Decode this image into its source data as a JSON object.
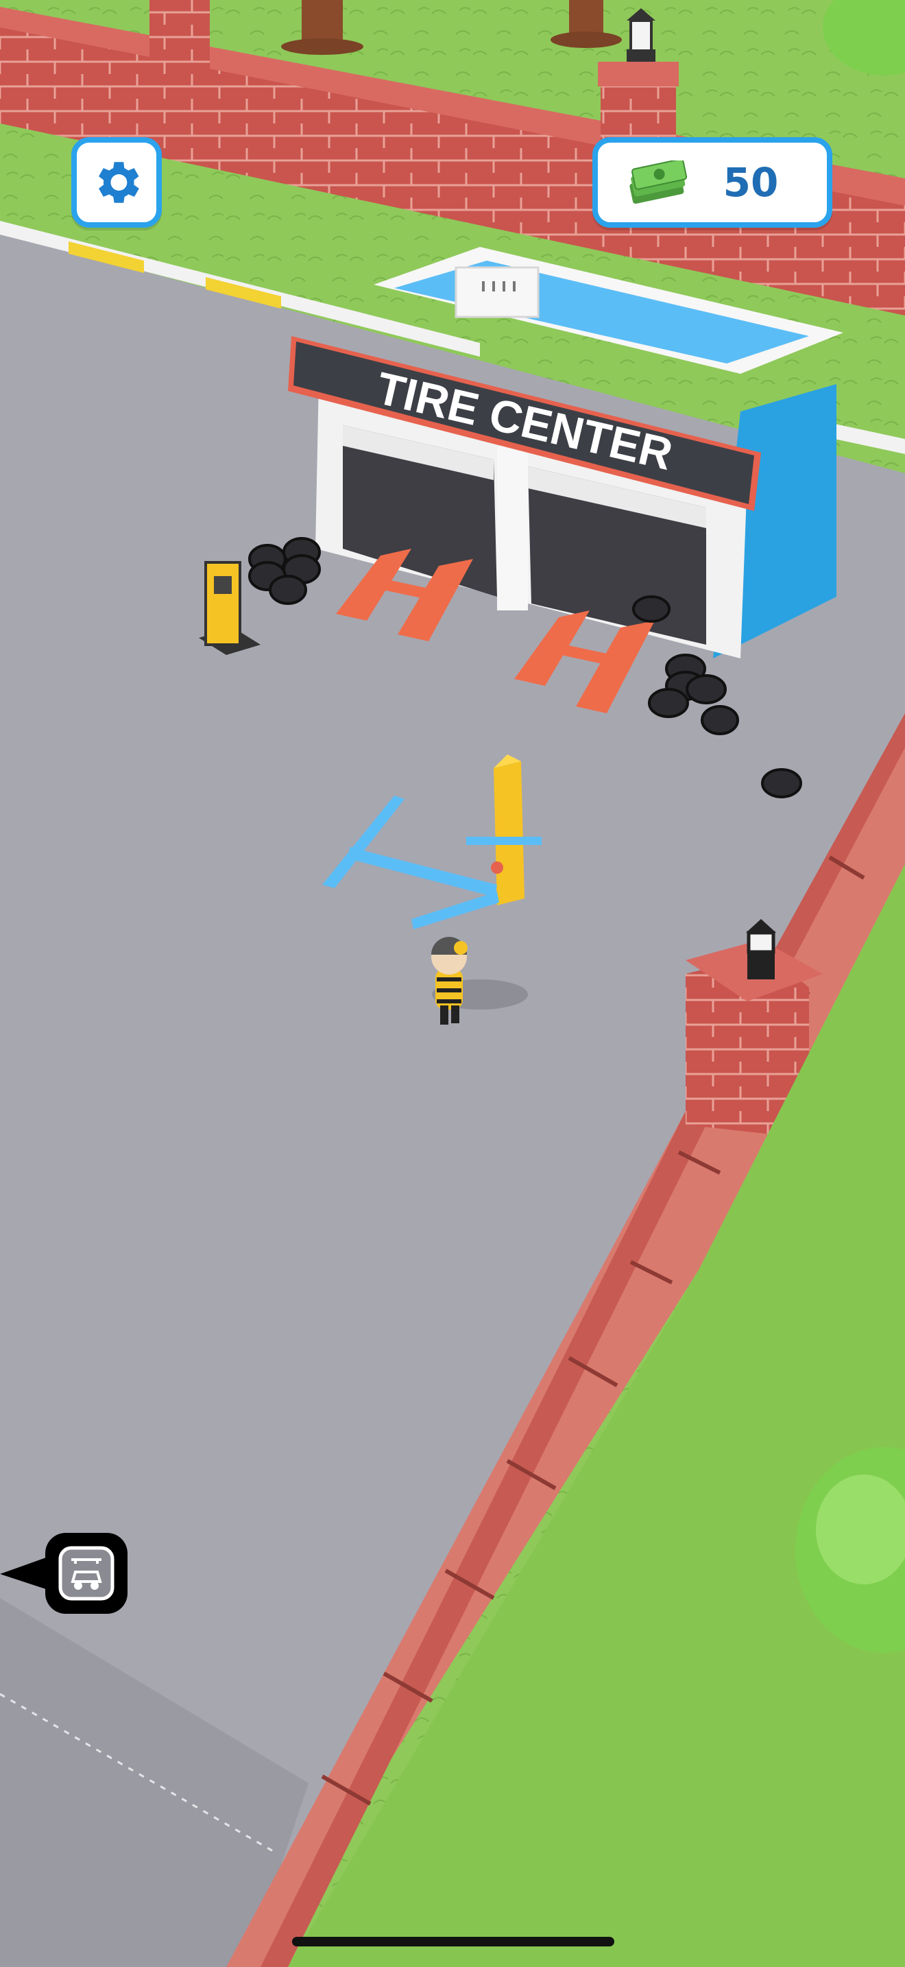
{
  "hud": {
    "settings_icon": "gear-icon",
    "money_icon": "cash-stack-icon",
    "money_amount": "50"
  },
  "building": {
    "sign_text": "TIRE CENTER"
  },
  "offscreen_marker": {
    "icon": "car-wash-icon",
    "direction": "left"
  },
  "colors": {
    "hud_border": "#2aa3ec",
    "money_text": "#1f6db4",
    "grass": "#8fc95a",
    "road": "#a7a7b0",
    "brick": "#c9554e",
    "building_roof": "#5bbdf6",
    "lift": "#5bbdf6",
    "lift_post": "#f5c324",
    "service_ramp": "#ef6c4a"
  }
}
